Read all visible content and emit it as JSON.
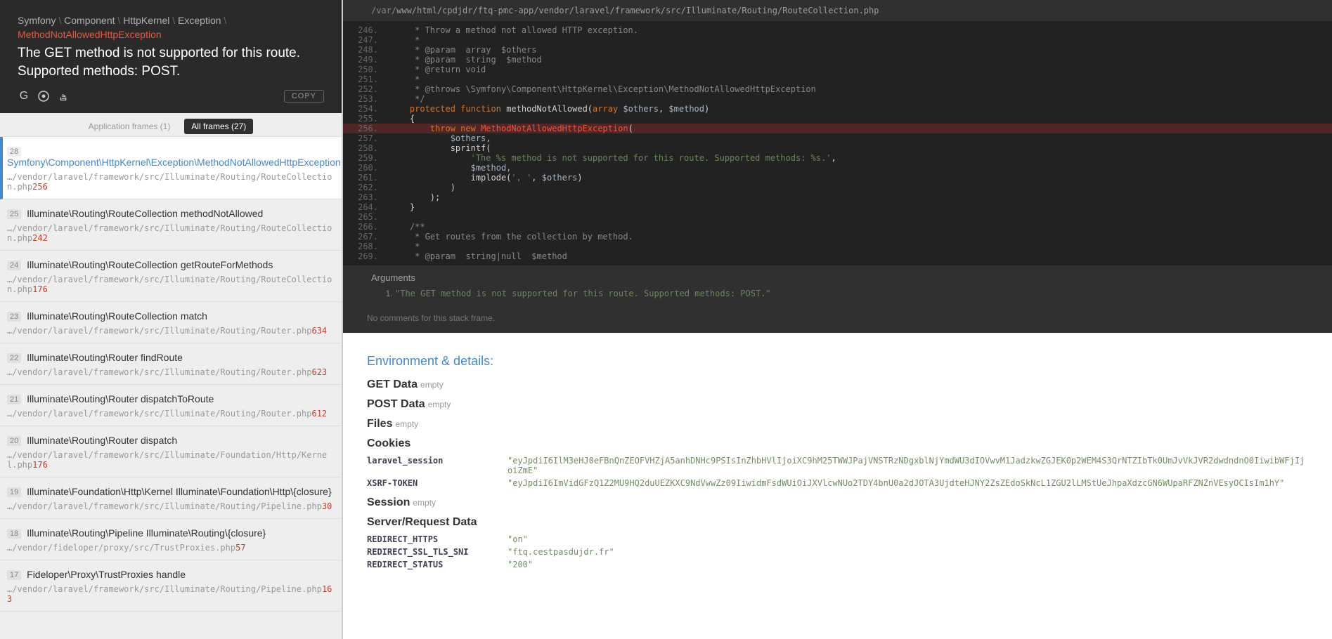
{
  "breadcrumb": [
    "Symfony",
    "Component",
    "HttpKernel",
    "Exception",
    "MethodNotAllowedHttpException"
  ],
  "exception_message": "The GET method is not supported for this route. Supported methods: POST.",
  "copy_label": "COPY",
  "filters": {
    "app": "Application frames (1)",
    "all": "All frames (27)"
  },
  "frames": [
    {
      "n": 28,
      "active": true,
      "title": "Symfony\\Component\\HttpKernel\\Exception\\MethodNotAllowedHttpException",
      "path": "…/vendor/laravel/framework/src/Illuminate/Routing/RouteCollection.php",
      "line": 256
    },
    {
      "n": 25,
      "title": "Illuminate\\Routing\\RouteCollection methodNotAllowed",
      "path": "…/vendor/laravel/framework/src/Illuminate/Routing/RouteCollection.php",
      "line": 242
    },
    {
      "n": 24,
      "title": "Illuminate\\Routing\\RouteCollection getRouteForMethods",
      "path": "…/vendor/laravel/framework/src/Illuminate/Routing/RouteCollection.php",
      "line": 176
    },
    {
      "n": 23,
      "title": "Illuminate\\Routing\\RouteCollection match",
      "path": "…/vendor/laravel/framework/src/Illuminate/Routing/Router.php",
      "line": 634
    },
    {
      "n": 22,
      "title": "Illuminate\\Routing\\Router findRoute",
      "path": "…/vendor/laravel/framework/src/Illuminate/Routing/Router.php",
      "line": 623
    },
    {
      "n": 21,
      "title": "Illuminate\\Routing\\Router dispatchToRoute",
      "path": "…/vendor/laravel/framework/src/Illuminate/Routing/Router.php",
      "line": 612
    },
    {
      "n": 20,
      "title": "Illuminate\\Routing\\Router dispatch",
      "path": "…/vendor/laravel/framework/src/Illuminate/Foundation/Http/Kernel.php",
      "line": 176
    },
    {
      "n": 19,
      "title": "Illuminate\\Foundation\\Http\\Kernel Illuminate\\Foundation\\Http\\{closure}",
      "path": "…/vendor/laravel/framework/src/Illuminate/Routing/Pipeline.php",
      "line": 30
    },
    {
      "n": 18,
      "title": "Illuminate\\Routing\\Pipeline Illuminate\\Routing\\{closure}",
      "path": "…/vendor/fideloper/proxy/src/TrustProxies.php",
      "line": 57
    },
    {
      "n": 17,
      "title": "Fideloper\\Proxy\\TrustProxies handle",
      "path": "…/vendor/laravel/framework/src/Illuminate/Routing/Pipeline.php",
      "line": 163
    }
  ],
  "code_file_prefix": "/var/",
  "code_file_rest": "www/html/cpdjdr/ftq-pmc-app/vendor/laravel/framework/src/Illuminate/Routing/RouteCollection.php",
  "code": [
    {
      "n": 246,
      "raw": "     * Throw a method not allowed HTTP exception.",
      "cls": "tok-comment"
    },
    {
      "n": 247,
      "raw": "     *",
      "cls": "tok-comment"
    },
    {
      "n": 248,
      "raw": "     * @param  array  $others",
      "cls": "tok-comment"
    },
    {
      "n": 249,
      "raw": "     * @param  string  $method",
      "cls": "tok-comment"
    },
    {
      "n": 250,
      "raw": "     * @return void",
      "cls": "tok-comment"
    },
    {
      "n": 251,
      "raw": "     *",
      "cls": "tok-comment"
    },
    {
      "n": 252,
      "raw": "     * @throws \\Symfony\\Component\\HttpKernel\\Exception\\MethodNotAllowedHttpException",
      "cls": "tok-comment"
    },
    {
      "n": 253,
      "raw": "     */",
      "cls": "tok-comment"
    },
    {
      "n": 254,
      "html": "    <span class='tok-keyword'>protected</span> <span class='tok-keyword'>function</span> <span class='tok-plain'>methodNotAllowed(</span><span class='tok-keyword'>array</span> <span class='tok-var'>$others</span><span class='tok-plain'>, </span><span class='tok-var'>$method</span><span class='tok-plain'>)</span>"
    },
    {
      "n": 255,
      "raw": "    {",
      "cls": "tok-plain"
    },
    {
      "n": 256,
      "hl": true,
      "html": "        <span class='tok-keyword'>throw</span> <span class='tok-keyword'>new</span> <span class='tok-class'>MethodNotAllowedHttpException</span><span class='tok-plain'>(</span>"
    },
    {
      "n": 257,
      "raw": "            $others,",
      "cls": "tok-var"
    },
    {
      "n": 258,
      "raw": "            sprintf(",
      "cls": "tok-plain"
    },
    {
      "n": 259,
      "html": "                <span class='tok-string'>'The %s method is not supported for this route. Supported methods: %s.'</span><span class='tok-plain'>,</span>"
    },
    {
      "n": 260,
      "raw": "                $method,",
      "cls": "tok-var"
    },
    {
      "n": 261,
      "html": "                <span class='tok-plain'>implode(</span><span class='tok-string'>', '</span><span class='tok-plain'>, </span><span class='tok-var'>$others</span><span class='tok-plain'>)</span>"
    },
    {
      "n": 262,
      "raw": "            )",
      "cls": "tok-plain"
    },
    {
      "n": 263,
      "raw": "        );",
      "cls": "tok-plain"
    },
    {
      "n": 264,
      "raw": "    }",
      "cls": "tok-plain"
    },
    {
      "n": 265,
      "raw": "",
      "cls": "tok-plain"
    },
    {
      "n": 266,
      "raw": "    /**",
      "cls": "tok-comment"
    },
    {
      "n": 267,
      "raw": "     * Get routes from the collection by method.",
      "cls": "tok-comment"
    },
    {
      "n": 268,
      "raw": "     *",
      "cls": "tok-comment"
    },
    {
      "n": 269,
      "raw": "     * @param  string|null  $method",
      "cls": "tok-comment"
    }
  ],
  "arguments_label": "Arguments",
  "arguments": [
    "\"The GET method is not supported for this route. Supported methods: POST.\""
  ],
  "comments_line": "No comments for this stack frame.",
  "env_header": "Environment & details:",
  "sections": [
    {
      "label": "GET Data",
      "empty": "empty"
    },
    {
      "label": "POST Data",
      "empty": "empty"
    },
    {
      "label": "Files",
      "empty": "empty"
    },
    {
      "label": "Cookies",
      "rows": [
        {
          "k": "laravel_session",
          "v": "\"eyJpdiI6IlM3eHJ0eFBnQnZEOFVHZjA5anhDNHc9PSIsInZhbHVlIjoiXC9hM25TWWJPajVNSTRzNDgxblNjYmdWU3dIOVwvM1JadzkwZGJEK0p2WEM4S3QrNTZIbTk0UmJvVkJVR2dwdndnO0IiwibWFjIjoiZmE\""
        },
        {
          "k": "XSRF-TOKEN",
          "v": "\"eyJpdiI6ImVidGFzQ1Z2MU9HQ2duUEZKXC9NdVwwZz09IiwidmFsdWUiOiJXVlcwNUo2TDY4bnU0a2dJOTA3UjdteHJNY2ZsZEdoSkNcL1ZGU2lLMStUeJhpaXdzcGN6WUpaRFZNZnVEsyOCIsIm1hY\""
        }
      ]
    },
    {
      "label": "Session",
      "empty": "empty"
    },
    {
      "label": "Server/Request Data",
      "rows": [
        {
          "k": "REDIRECT_HTTPS",
          "v": "\"on\""
        },
        {
          "k": "REDIRECT_SSL_TLS_SNI",
          "v": "\"ftq.cestpasdujdr.fr\""
        },
        {
          "k": "REDIRECT_STATUS",
          "v": "\"200\""
        }
      ]
    }
  ]
}
